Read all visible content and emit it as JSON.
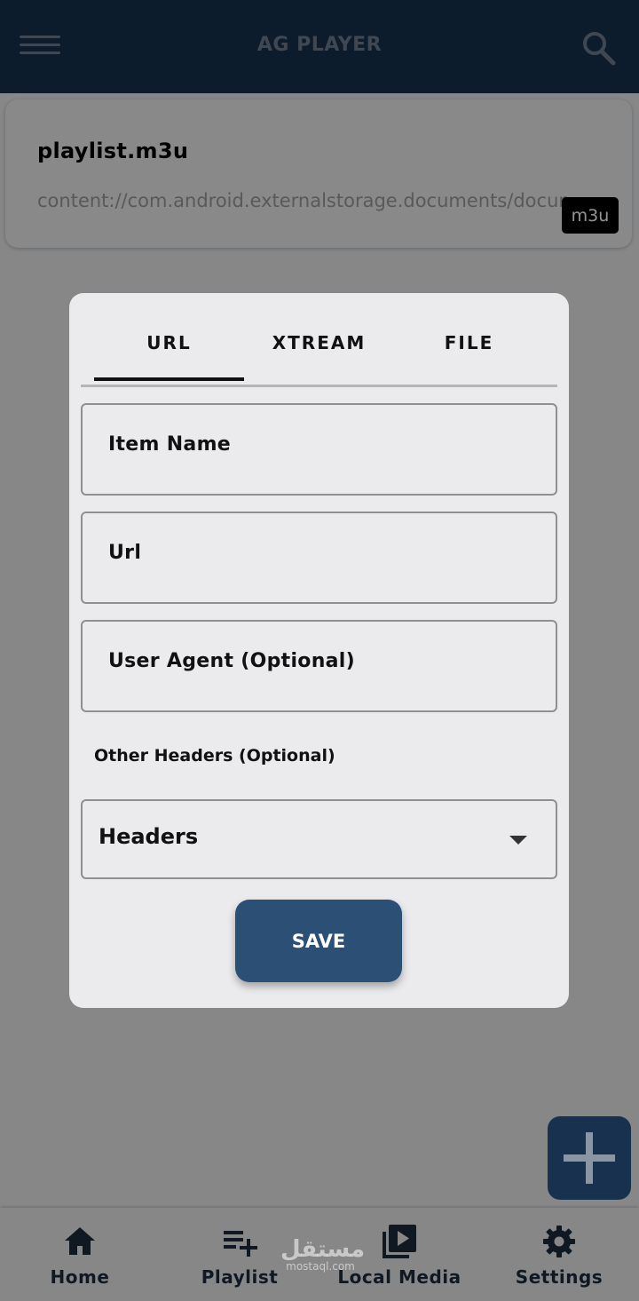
{
  "app_bar": {
    "title": "AG PLAYER",
    "menu_icon": "hamburger-menu-icon",
    "search_icon": "search-icon"
  },
  "playlist_card": {
    "name": "playlist.m3u",
    "path": "content://com.android.externalstorage.documents/document",
    "badge": "m3u"
  },
  "dialog": {
    "tabs": [
      {
        "label": "URL",
        "active": true
      },
      {
        "label": "XTREAM",
        "active": false
      },
      {
        "label": "FILE",
        "active": false
      }
    ],
    "fields": {
      "item_name": "Item Name",
      "url": "Url",
      "user_agent": "User Agent (Optional)"
    },
    "other_headers_label": "Other Headers (Optional)",
    "headers_select": {
      "value": "Headers"
    },
    "save_label": "SAVE"
  },
  "fab": {
    "icon": "plus-icon"
  },
  "bottom_nav": {
    "items": [
      {
        "label": "Home",
        "icon": "home-icon"
      },
      {
        "label": "Playlist",
        "icon": "playlist-add-icon"
      },
      {
        "label": "Local Media",
        "icon": "video-library-icon"
      },
      {
        "label": "Settings",
        "icon": "gear-icon"
      }
    ]
  },
  "watermark": {
    "text": "مستقل",
    "sub": "mostaql.com"
  },
  "colors": {
    "primary": "#17314f",
    "button": "#2c4f75",
    "surface": "#ebebed"
  }
}
